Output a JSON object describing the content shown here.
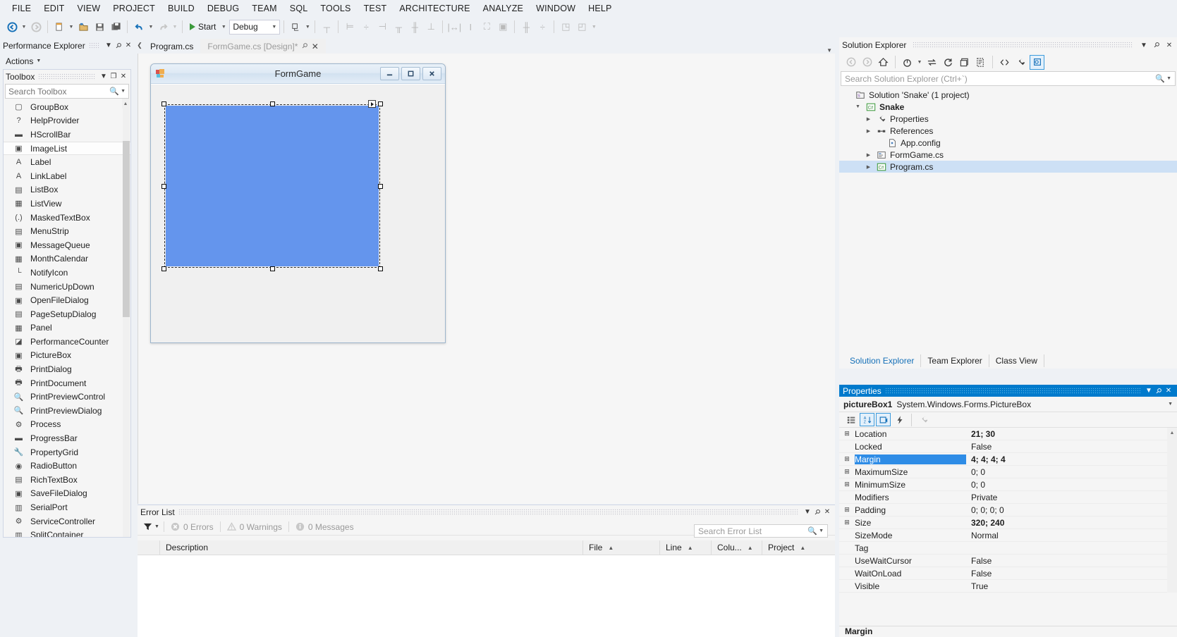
{
  "menubar": {
    "items": [
      "FILE",
      "EDIT",
      "VIEW",
      "PROJECT",
      "BUILD",
      "DEBUG",
      "TEAM",
      "SQL",
      "TOOLS",
      "TEST",
      "ARCHITECTURE",
      "ANALYZE",
      "WINDOW",
      "HELP"
    ]
  },
  "toolbar": {
    "start_label": "Start",
    "config_value": "Debug",
    "nav_back": "navigate-backward",
    "nav_forward": "navigate-forward"
  },
  "performance_explorer": {
    "title": "Performance Explorer",
    "actions_label": "Actions"
  },
  "toolbox": {
    "title": "Toolbox",
    "search_placeholder": "Search Toolbox",
    "items": [
      {
        "label": "GroupBox",
        "icon": "groupbox-icon",
        "glyph": "▢"
      },
      {
        "label": "HelpProvider",
        "icon": "helpprovider-icon",
        "glyph": "?"
      },
      {
        "label": "HScrollBar",
        "icon": "hscrollbar-icon",
        "glyph": "▬"
      },
      {
        "label": "ImageList",
        "icon": "imagelist-icon",
        "glyph": "▣",
        "selected": true
      },
      {
        "label": "Label",
        "icon": "label-icon",
        "glyph": "A"
      },
      {
        "label": "LinkLabel",
        "icon": "linklabel-icon",
        "glyph": "A"
      },
      {
        "label": "ListBox",
        "icon": "listbox-icon",
        "glyph": "▤"
      },
      {
        "label": "ListView",
        "icon": "listview-icon",
        "glyph": "▦"
      },
      {
        "label": "MaskedTextBox",
        "icon": "maskedtextbox-icon",
        "glyph": "(.)"
      },
      {
        "label": "MenuStrip",
        "icon": "menustrip-icon",
        "glyph": "▤"
      },
      {
        "label": "MessageQueue",
        "icon": "messagequeue-icon",
        "glyph": "▣"
      },
      {
        "label": "MonthCalendar",
        "icon": "monthcalendar-icon",
        "glyph": "▦"
      },
      {
        "label": "NotifyIcon",
        "icon": "notifyicon-icon",
        "glyph": "└"
      },
      {
        "label": "NumericUpDown",
        "icon": "numericupdown-icon",
        "glyph": "▤"
      },
      {
        "label": "OpenFileDialog",
        "icon": "openfiledialog-icon",
        "glyph": "▣"
      },
      {
        "label": "PageSetupDialog",
        "icon": "pagesetupdialog-icon",
        "glyph": "▤"
      },
      {
        "label": "Panel",
        "icon": "panel-icon",
        "glyph": "▦"
      },
      {
        "label": "PerformanceCounter",
        "icon": "performancecounter-icon",
        "glyph": "◪"
      },
      {
        "label": "PictureBox",
        "icon": "picturebox-icon",
        "glyph": "▣"
      },
      {
        "label": "PrintDialog",
        "icon": "printdialog-icon",
        "glyph": "🖶"
      },
      {
        "label": "PrintDocument",
        "icon": "printdocument-icon",
        "glyph": "🖶"
      },
      {
        "label": "PrintPreviewControl",
        "icon": "printpreviewcontrol-icon",
        "glyph": "🔍"
      },
      {
        "label": "PrintPreviewDialog",
        "icon": "printpreviewdialog-icon",
        "glyph": "🔍"
      },
      {
        "label": "Process",
        "icon": "process-icon",
        "glyph": "⚙"
      },
      {
        "label": "ProgressBar",
        "icon": "progressbar-icon",
        "glyph": "▬"
      },
      {
        "label": "PropertyGrid",
        "icon": "propertygrid-icon",
        "glyph": "🔧"
      },
      {
        "label": "RadioButton",
        "icon": "radiobutton-icon",
        "glyph": "◉"
      },
      {
        "label": "RichTextBox",
        "icon": "richtextbox-icon",
        "glyph": "▤"
      },
      {
        "label": "SaveFileDialog",
        "icon": "savefiledialog-icon",
        "glyph": "▣"
      },
      {
        "label": "SerialPort",
        "icon": "serialport-icon",
        "glyph": "▥"
      },
      {
        "label": "ServiceController",
        "icon": "servicecontroller-icon",
        "glyph": "⚙"
      },
      {
        "label": "SplitContainer",
        "icon": "splitcontainer-icon",
        "glyph": "▥"
      }
    ]
  },
  "tabs": [
    {
      "label": "Program.cs",
      "active": false
    },
    {
      "label": "FormGame.cs [Design]*",
      "active": true
    }
  ],
  "designer": {
    "form_caption": "FormGame",
    "minimize_label": "—",
    "maximize_label": "❐",
    "close_label": "✕",
    "picturebox_color": "#6495ED",
    "selected_control": "pictureBox1"
  },
  "error_list": {
    "title": "Error List",
    "errors_label": "0 Errors",
    "warnings_label": "0 Warnings",
    "messages_label": "0 Messages",
    "search_placeholder": "Search Error List",
    "columns": [
      "Description",
      "File",
      "Line",
      "Colu...",
      "Project"
    ],
    "rows": []
  },
  "solution_explorer": {
    "title": "Solution Explorer",
    "search_placeholder": "Search Solution Explorer (Ctrl+`)",
    "tree": [
      {
        "label": "Solution 'Snake' (1 project)",
        "icon": "solution-icon",
        "indent": 0,
        "expander": "",
        "bold": false,
        "selected": false
      },
      {
        "label": "Snake",
        "icon": "csharp-project-icon",
        "indent": 1,
        "expander": "▼",
        "bold": true,
        "selected": false
      },
      {
        "label": "Properties",
        "icon": "properties-icon",
        "indent": 2,
        "expander": "▶",
        "bold": false,
        "selected": false
      },
      {
        "label": "References",
        "icon": "references-icon",
        "indent": 2,
        "expander": "▶",
        "bold": false,
        "selected": false
      },
      {
        "label": "App.config",
        "icon": "config-file-icon",
        "indent": 3,
        "expander": "",
        "bold": false,
        "selected": false
      },
      {
        "label": "FormGame.cs",
        "icon": "form-file-icon",
        "indent": 2,
        "expander": "▶",
        "bold": false,
        "selected": false
      },
      {
        "label": "Program.cs",
        "icon": "csharp-file-icon",
        "indent": 2,
        "expander": "▶",
        "bold": false,
        "selected": true
      }
    ],
    "bottom_tabs": [
      {
        "label": "Solution Explorer",
        "active": true
      },
      {
        "label": "Team Explorer",
        "active": false
      },
      {
        "label": "Class View",
        "active": false
      }
    ]
  },
  "properties": {
    "title": "Properties",
    "object_name": "pictureBox1",
    "object_type": "System.Windows.Forms.PictureBox",
    "description_header": "Margin",
    "rows": [
      {
        "key": "Location",
        "value": "21; 30",
        "expandable": true,
        "bold": true,
        "selected": false
      },
      {
        "key": "Locked",
        "value": "False",
        "expandable": false,
        "bold": false,
        "selected": false
      },
      {
        "key": "Margin",
        "value": "4; 4; 4; 4",
        "expandable": true,
        "bold": true,
        "selected": true
      },
      {
        "key": "MaximumSize",
        "value": "0; 0",
        "expandable": true,
        "bold": false,
        "selected": false
      },
      {
        "key": "MinimumSize",
        "value": "0; 0",
        "expandable": true,
        "bold": false,
        "selected": false
      },
      {
        "key": "Modifiers",
        "value": "Private",
        "expandable": false,
        "bold": false,
        "selected": false
      },
      {
        "key": "Padding",
        "value": "0; 0; 0; 0",
        "expandable": true,
        "bold": false,
        "selected": false
      },
      {
        "key": "Size",
        "value": "320; 240",
        "expandable": true,
        "bold": true,
        "selected": false
      },
      {
        "key": "SizeMode",
        "value": "Normal",
        "expandable": false,
        "bold": false,
        "selected": false
      },
      {
        "key": "Tag",
        "value": "",
        "expandable": false,
        "bold": false,
        "selected": false
      },
      {
        "key": "UseWaitCursor",
        "value": "False",
        "expandable": false,
        "bold": false,
        "selected": false
      },
      {
        "key": "WaitOnLoad",
        "value": "False",
        "expandable": false,
        "bold": false,
        "selected": false
      },
      {
        "key": "Visible",
        "value": "True",
        "expandable": false,
        "bold": false,
        "selected": false
      }
    ]
  },
  "colors": {
    "accent": "#007acc",
    "selection": "#2e8ce6",
    "picturebox": "#6495ED",
    "tree_selection": "#cde0f5"
  }
}
